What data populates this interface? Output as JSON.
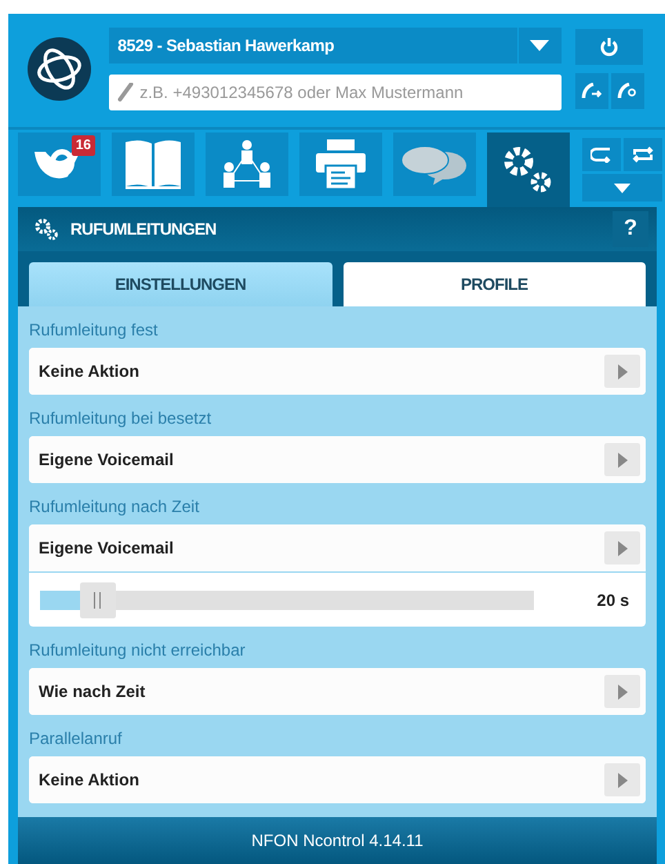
{
  "header": {
    "user": "8529 - Sebastian Hawerkamp",
    "search": {
      "placeholder": "z.B. +493012345678 oder Max Mustermann"
    }
  },
  "nav": [
    {
      "kind": "horn",
      "selected": false,
      "badge": "16"
    },
    {
      "kind": "book",
      "selected": false
    },
    {
      "kind": "people",
      "selected": false
    },
    {
      "kind": "printer",
      "selected": false
    },
    {
      "kind": "chat",
      "selected": false
    },
    {
      "kind": "gears",
      "selected": true
    }
  ],
  "panel": {
    "title": "RUFUMLEITUNGEN",
    "help": "?"
  },
  "tabs": [
    {
      "label": "EINSTELLUNGEN",
      "selected": true
    },
    {
      "label": "PROFILE",
      "selected": false
    }
  ],
  "settings": [
    {
      "label": "Rufumleitung fest",
      "value": "Keine Aktion"
    },
    {
      "label": "Rufumleitung bei besetzt",
      "value": "Eigene Voicemail"
    },
    {
      "label": "Rufumleitung nach Zeit",
      "value": "Eigene Voicemail",
      "slider": {
        "level": 0.1,
        "reading": "20 s"
      }
    },
    {
      "label": "Rufumleitung nicht erreichbar",
      "value": "Wie nach Zeit"
    },
    {
      "label": "Parallelanruf",
      "value": "Keine Aktion"
    }
  ],
  "footer": "NFON Ncontrol 4.14.11"
}
